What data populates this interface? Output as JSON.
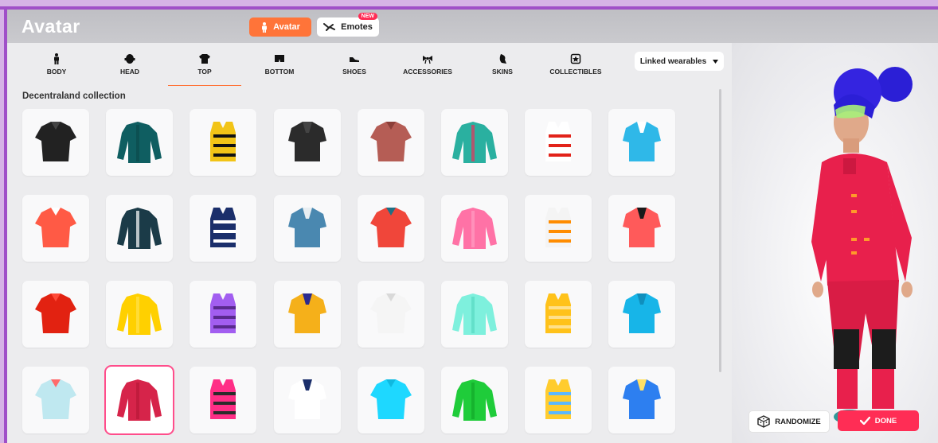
{
  "header": {
    "title": "Avatar"
  },
  "tabs": [
    {
      "label": "Avatar",
      "icon": "person-icon",
      "color": "#ff7439"
    },
    {
      "label": "Emotes",
      "icon": "emote-icon",
      "badge": "NEW"
    }
  ],
  "categories": [
    {
      "label": "BODY",
      "icon": "body-icon"
    },
    {
      "label": "HEAD",
      "icon": "head-icon"
    },
    {
      "label": "TOP",
      "icon": "shirt-icon",
      "active": true
    },
    {
      "label": "BOTTOM",
      "icon": "pants-icon"
    },
    {
      "label": "SHOES",
      "icon": "shoe-icon"
    },
    {
      "label": "ACCESSORIES",
      "icon": "bow-icon"
    },
    {
      "label": "SKINS",
      "icon": "skin-icon"
    },
    {
      "label": "COLLECTIBLES",
      "icon": "collectible-icon"
    }
  ],
  "linked": {
    "label": "Linked wearables"
  },
  "collection": {
    "label": "Decentraland collection"
  },
  "items": [
    {
      "name": "black-polo",
      "color": "#222222",
      "accent": "#444444"
    },
    {
      "name": "teal-hoodie",
      "color": "#0f5e61",
      "accent": "#0b4a4c"
    },
    {
      "name": "yellow-striped-tee",
      "color": "#f2c417",
      "accent": "#111111"
    },
    {
      "name": "black-vest",
      "color": "#2b2b2b",
      "accent": "#444444"
    },
    {
      "name": "rust-tank",
      "color": "#b55d55",
      "accent": "#8c3f39"
    },
    {
      "name": "rainbow-sweater",
      "color": "#2ab0a0",
      "accent": "#e8325a"
    },
    {
      "name": "red-striped-jacket",
      "color": "#ffffff",
      "accent": "#e2231a"
    },
    {
      "name": "blue-overalls",
      "color": "#2fb8e8",
      "accent": "#ffffff"
    },
    {
      "name": "coral-overalls",
      "color": "#ff5a45",
      "accent": "#ffffff"
    },
    {
      "name": "striped-tank",
      "color": "#1b3b48",
      "accent": "#ffffff"
    },
    {
      "name": "navy-sailor-shirt",
      "color": "#1b2f6b",
      "accent": "#ffffff"
    },
    {
      "name": "blue-blazer",
      "color": "#4a88b0",
      "accent": "#e8eef2"
    },
    {
      "name": "red-bikini-top",
      "color": "#f0463a",
      "accent": "#1f6f84"
    },
    {
      "name": "pink-tee",
      "color": "#ff72a6",
      "accent": "#ff9dc3"
    },
    {
      "name": "rainbow-tank",
      "color": "#f4f4f4",
      "accent": "#ff8c00"
    },
    {
      "name": "coral-jacket",
      "color": "#ff5a5a",
      "accent": "#1a1a1a"
    },
    {
      "name": "red-tee",
      "color": "#e22211",
      "accent": "#ff4a38"
    },
    {
      "name": "yellow-tee",
      "color": "#ffd000",
      "accent": "#ffe14d"
    },
    {
      "name": "purple-tee",
      "color": "#a25ef0",
      "accent": "#5a2a8f"
    },
    {
      "name": "mustard-jacket",
      "color": "#f5b01a",
      "accent": "#2b2b8f"
    },
    {
      "name": "white-shirt",
      "color": "#f5f5f5",
      "accent": "#d9d9d9"
    },
    {
      "name": "mint-shirt",
      "color": "#7ef0dd",
      "accent": "#58d9c2"
    },
    {
      "name": "yellow-shirt",
      "color": "#ffc21a",
      "accent": "#ffe08a"
    },
    {
      "name": "cyan-polo",
      "color": "#17b5e8",
      "accent": "#0f8fbd"
    },
    {
      "name": "striped-shirt",
      "color": "#bfe8f0",
      "accent": "#ff6b6b"
    },
    {
      "name": "pink-blazer",
      "color": "#d6244a",
      "accent": "#b81838",
      "selected": true
    },
    {
      "name": "pink-vest",
      "color": "#ff2e86",
      "accent": "#2b2b2b"
    },
    {
      "name": "sailor-uniform",
      "color": "#ffffff",
      "accent": "#1b2f6b"
    },
    {
      "name": "cyan-tee",
      "color": "#1ed8ff",
      "accent": "#0fb9e0"
    },
    {
      "name": "green-tee",
      "color": "#1fcc3a",
      "accent": "#12a82a"
    },
    {
      "name": "colorblock-tee",
      "color": "#ffcc2e",
      "accent": "#5bb8ff"
    },
    {
      "name": "colorblock-shirt",
      "color": "#2d7ff0",
      "accent": "#ffe066"
    }
  ],
  "actions": {
    "randomize": "RANDOMIZE",
    "done": "DONE"
  },
  "colors": {
    "accent": "#ff7439",
    "primary": "#ff2d55",
    "selection": "#ff4d8b"
  }
}
